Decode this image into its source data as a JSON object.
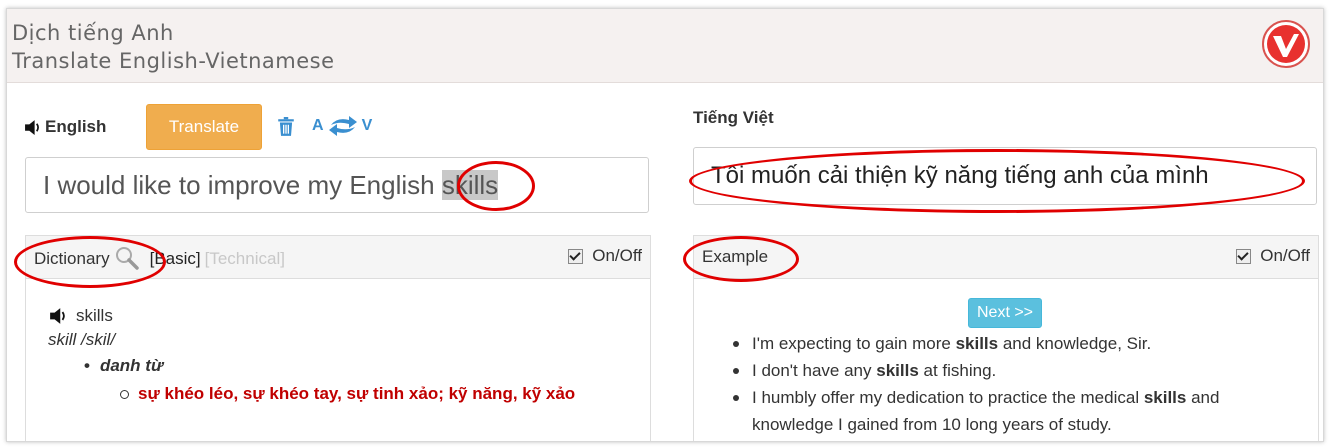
{
  "header": {
    "title_vi": "Dịch tiếng Anh",
    "title_en": "Translate English-Vietnamese"
  },
  "source": {
    "language_label": "English",
    "translate_button": "Translate",
    "swap_from": "A",
    "swap_to": "V",
    "input_text_before": "I would like to improve my English ",
    "input_highlight": "skills"
  },
  "target": {
    "language_label": "Tiếng Việt",
    "output_text": "Tôi muốn cải thiện kỹ năng tiếng anh của mình"
  },
  "dictionary": {
    "title": "Dictionary",
    "mode_basic": "[Basic]",
    "mode_technical": "[Technical]",
    "toggle_label": "On/Off",
    "toggle_checked": true,
    "word": "skills",
    "pronunciation": "skill /skil/",
    "part_of_speech": "danh từ",
    "meaning": "sự khéo léo, sự khéo tay, sự tinh xảo; kỹ năng, kỹ xảo"
  },
  "example": {
    "title": "Example",
    "toggle_label": "On/Off",
    "toggle_checked": true,
    "next_button": "Next >>",
    "items": [
      {
        "before": "I'm expecting to gain more ",
        "bold": "skills",
        "after": " and knowledge, Sir."
      },
      {
        "before": "I don't have any ",
        "bold": "skills",
        "after": " at fishing."
      },
      {
        "before": "I humbly offer my dedication to practice the medical ",
        "bold": "skills",
        "after": " and knowledge I gained from 10 long years of study."
      }
    ]
  },
  "colors": {
    "translate_button": "#f0ad4e",
    "next_button": "#5bc0de",
    "meaning_text": "#c00000",
    "annotation_ellipse": "#e00000",
    "swap_icon": "#3a8fd0"
  },
  "icons": {
    "speaker": "speaker-icon",
    "trash": "trash-icon",
    "swap": "swap-arrows-icon",
    "magnifier": "magnifier-icon",
    "logo": "v-logo-icon"
  }
}
